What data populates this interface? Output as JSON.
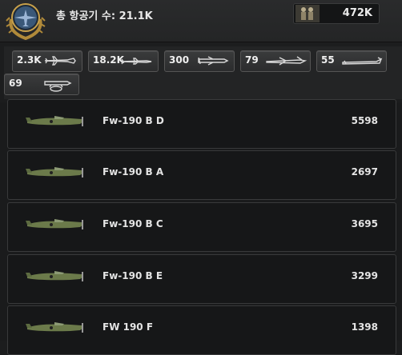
{
  "header": {
    "title": "총 항공기 수: 21.1K",
    "manpower_value": "472K"
  },
  "filters": [
    {
      "count": "2.3K",
      "icon": "fighter-icon"
    },
    {
      "count": "18.2K",
      "icon": "heavy-fighter-icon"
    },
    {
      "count": "300",
      "icon": "cas-icon"
    },
    {
      "count": "79",
      "icon": "tactical-bomber-icon"
    },
    {
      "count": "55",
      "icon": "strategic-bomber-icon"
    },
    {
      "count": "69",
      "icon": "naval-bomber-icon"
    }
  ],
  "aircraft": [
    {
      "name": "Fw-190 B D",
      "value": "5598"
    },
    {
      "name": "Fw-190 B A",
      "value": "2697"
    },
    {
      "name": "Fw-190 B C",
      "value": "3695"
    },
    {
      "name": "Fw-190 B E",
      "value": "3299"
    },
    {
      "name": "FW 190 F",
      "value": "1398"
    }
  ],
  "colors": {
    "background": "#1c1d1e",
    "row_background": "#161718",
    "row_border": "#393a3b",
    "chip_background": "#333435",
    "text": "#e6e6e6",
    "emblem_gold": "#b08a3a",
    "emblem_blue": "#5b7fa8",
    "plane_camo": "#6b7a4a"
  }
}
